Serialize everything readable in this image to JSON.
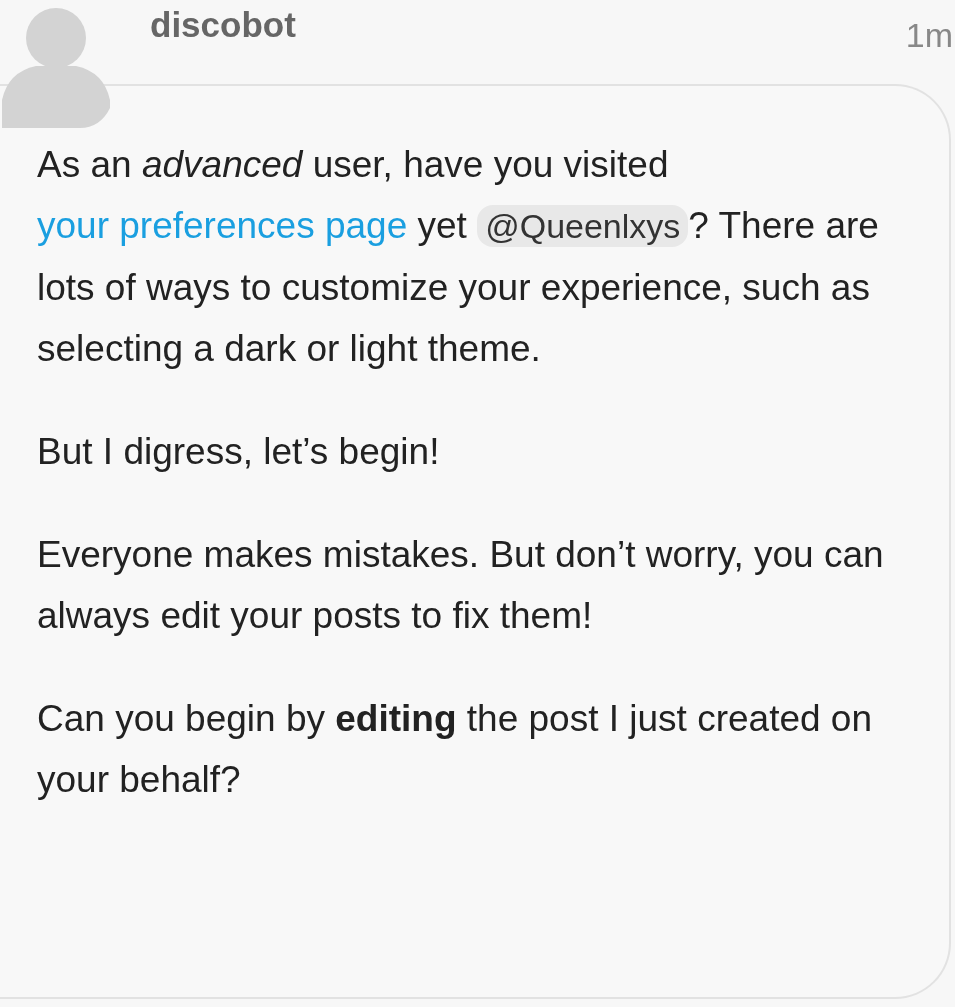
{
  "post": {
    "username": "discobot",
    "time": "1m",
    "paragraphs": [
      {
        "parts": [
          {
            "kind": "text",
            "text": "As an *advanced* user, have you visited "
          },
          {
            "kind": "link",
            "text": "your preferences page"
          },
          {
            "kind": "text",
            "text": " yet "
          },
          {
            "kind": "mention",
            "text": "@Queenlxys"
          },
          {
            "kind": "text",
            "text": "? There are lots of ways to customize your experience, such as selecting a dark or light theme."
          }
        ]
      },
      {
        "parts": [
          {
            "kind": "text",
            "text": "But I digress, let’s begin!"
          }
        ]
      },
      {
        "parts": [
          {
            "kind": "text",
            "text": "Everyone makes mistakes. But don’t worry, you can always edit your posts to fix them!"
          }
        ]
      },
      {
        "parts": [
          {
            "kind": "text",
            "text": "Can you begin by **editing** the post I just created on your behalf?"
          }
        ]
      }
    ]
  }
}
